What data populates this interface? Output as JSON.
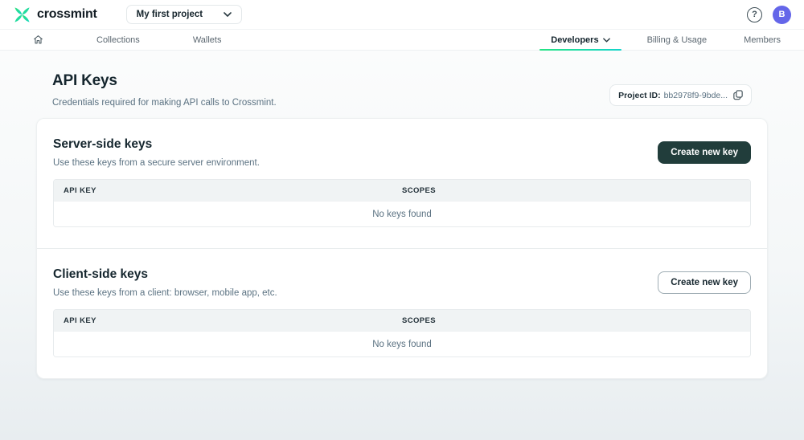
{
  "topbar": {
    "brand": "crossmint",
    "project_selector": "My first project",
    "help_glyph": "?",
    "avatar_initial": "B"
  },
  "nav": {
    "left": [
      {
        "label": "Collections"
      },
      {
        "label": "Wallets"
      }
    ],
    "right": [
      {
        "label": "Developers",
        "active": true
      },
      {
        "label": "Billing & Usage"
      },
      {
        "label": "Members"
      }
    ]
  },
  "page": {
    "title": "API Keys",
    "subtitle": "Credentials required for making API calls to Crossmint.",
    "project_id_label": "Project ID:",
    "project_id_value": "bb2978f9-9bde..."
  },
  "sections": [
    {
      "title": "Server-side keys",
      "description": "Use these keys from a secure server environment.",
      "button_label": "Create new key",
      "table": {
        "headers": [
          "API KEY",
          "SCOPES"
        ],
        "empty_message": "No keys found"
      }
    },
    {
      "title": "Client-side keys",
      "description": "Use these keys from a client: browser, mobile app, etc.",
      "button_label": "Create new key",
      "table": {
        "headers": [
          "API KEY",
          "SCOPES"
        ],
        "empty_message": "No keys found"
      }
    }
  ],
  "colors": {
    "accent_green": "#2ee27a",
    "accent_teal": "#16d6c3",
    "avatar_bg": "#6466e9",
    "dark_button_bg": "#213d3b"
  }
}
